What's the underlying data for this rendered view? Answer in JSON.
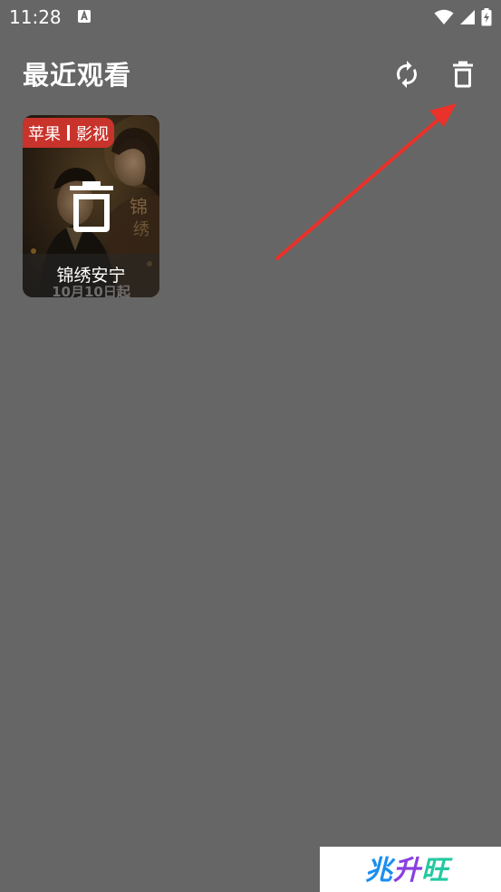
{
  "status_bar": {
    "time": "11:28",
    "icons": [
      "a-notification-icon",
      "wifi-icon",
      "signal-icon",
      "battery-charging-icon"
    ]
  },
  "header": {
    "title": "最近观看",
    "refresh_icon": "sync-icon",
    "delete_icon": "trash-icon"
  },
  "history": {
    "items": [
      {
        "badge_left": "苹果",
        "badge_right": "影视",
        "title": "锦绣安宁",
        "poster_date": "10月10日起",
        "overlay_icon": "trash-icon"
      }
    ]
  },
  "watermark": {
    "c1": "兆",
    "c2": "升",
    "c3": "旺"
  },
  "colors": {
    "background": "#666666",
    "badge": "#c8332b",
    "annotation_arrow": "#e8322a"
  }
}
